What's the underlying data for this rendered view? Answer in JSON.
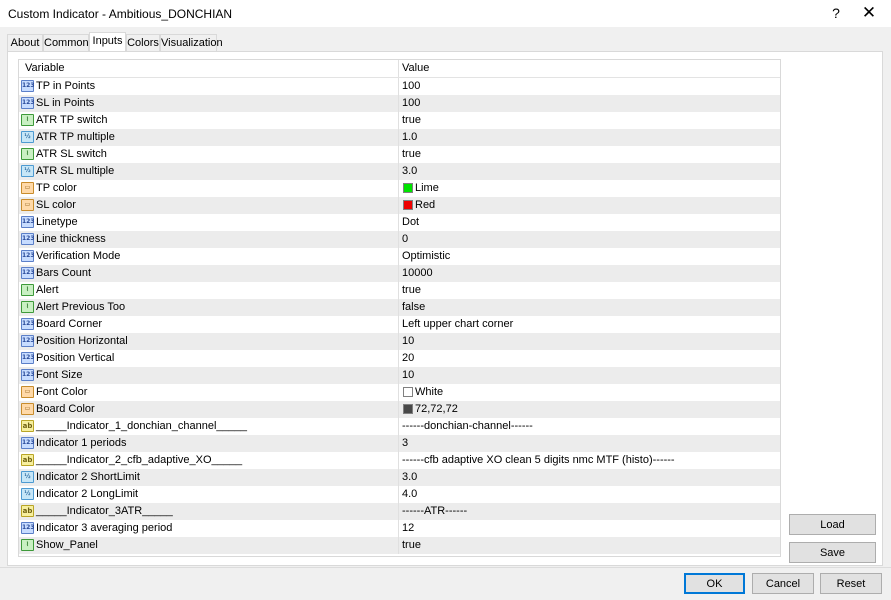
{
  "window": {
    "title": "Custom Indicator - Ambitious_DONCHIAN",
    "help_label": "?",
    "close_label": "✕"
  },
  "tabs": [
    {
      "label": "About"
    },
    {
      "label": "Common"
    },
    {
      "label": "Inputs",
      "active": true
    },
    {
      "label": "Colors"
    },
    {
      "label": "Visualization"
    }
  ],
  "grid": {
    "headers": {
      "variable": "Variable",
      "value": "Value"
    },
    "rows": [
      {
        "type": "int",
        "name": "TP in Points",
        "value": "100"
      },
      {
        "type": "int",
        "name": "SL in Points",
        "value": "100"
      },
      {
        "type": "bool",
        "name": "ATR TP switch",
        "value": "true"
      },
      {
        "type": "dbl",
        "name": "ATR TP multiple",
        "value": "1.0"
      },
      {
        "type": "bool",
        "name": "ATR SL switch",
        "value": "true"
      },
      {
        "type": "dbl",
        "name": "ATR SL multiple",
        "value": "3.0"
      },
      {
        "type": "color",
        "name": "TP color",
        "value": "Lime",
        "swatch": "#00e400"
      },
      {
        "type": "color",
        "name": "SL color",
        "value": "Red",
        "swatch": "#ee0000"
      },
      {
        "type": "int",
        "name": "Linetype",
        "value": "Dot"
      },
      {
        "type": "int",
        "name": "Line thickness",
        "value": "0"
      },
      {
        "type": "int",
        "name": "Verification Mode",
        "value": "Optimistic"
      },
      {
        "type": "int",
        "name": "Bars Count",
        "value": "10000"
      },
      {
        "type": "bool",
        "name": "Alert",
        "value": "true"
      },
      {
        "type": "bool",
        "name": "Alert Previous Too",
        "value": "false"
      },
      {
        "type": "int",
        "name": "Board Corner",
        "value": "Left upper chart corner"
      },
      {
        "type": "int",
        "name": "Position Horizontal",
        "value": "10"
      },
      {
        "type": "int",
        "name": "Position Vertical",
        "value": "20"
      },
      {
        "type": "int",
        "name": "Font Size",
        "value": "10"
      },
      {
        "type": "color",
        "name": "Font Color",
        "value": "White",
        "swatch": "#ffffff"
      },
      {
        "type": "color",
        "name": "Board Color",
        "value": "72,72,72",
        "swatch": "#484848"
      },
      {
        "type": "str",
        "name": "_____Indicator_1_donchian_channel_____",
        "value": "------donchian-channel------"
      },
      {
        "type": "int",
        "name": "Indicator 1 periods",
        "value": "3"
      },
      {
        "type": "str",
        "name": "_____Indicator_2_cfb_adaptive_XO_____",
        "value": "------cfb adaptive XO clean 5 digits nmc MTF (histo)------"
      },
      {
        "type": "dbl",
        "name": "Indicator 2 ShortLimit",
        "value": "3.0"
      },
      {
        "type": "dbl",
        "name": "Indicator 2 LongLimit",
        "value": "4.0"
      },
      {
        "type": "str",
        "name": "_____Indicator_3ATR_____",
        "value": "------ATR------"
      },
      {
        "type": "int",
        "name": "Indicator 3 averaging period",
        "value": "12"
      },
      {
        "type": "bool",
        "name": "Show_Panel",
        "value": "true"
      }
    ]
  },
  "icon_glyphs": {
    "int": "123",
    "bool": "⌇",
    "dbl": "½",
    "color": "▭",
    "str": "ab"
  },
  "buttons": {
    "load": "Load",
    "save": "Save",
    "ok": "OK",
    "cancel": "Cancel",
    "reset": "Reset"
  }
}
